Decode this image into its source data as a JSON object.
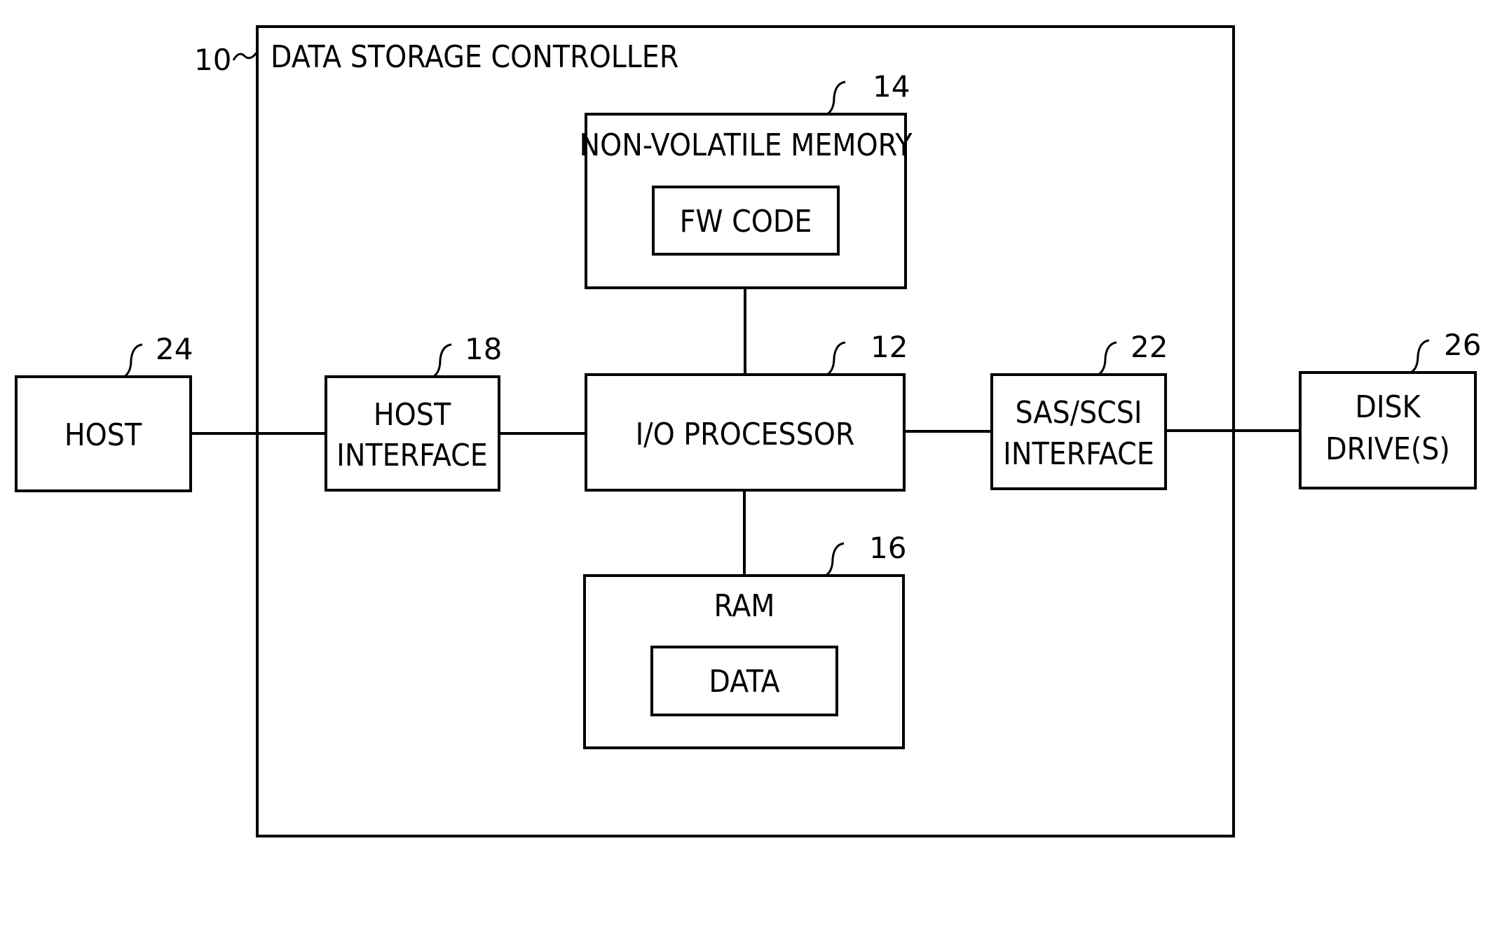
{
  "controller": {
    "ref": "10",
    "label": "DATA STORAGE CONTROLLER"
  },
  "blocks": {
    "nvm": {
      "ref": "14",
      "label": "NON-VOLATILE MEMORY",
      "inner": "FW CODE"
    },
    "io": {
      "ref": "12",
      "label": "I/O PROCESSOR"
    },
    "ram": {
      "ref": "16",
      "label": "RAM",
      "inner": "DATA"
    },
    "host": {
      "ref": "24",
      "label": "HOST"
    },
    "host_if": {
      "ref": "18",
      "line1": "HOST",
      "line2": "INTERFACE"
    },
    "sas": {
      "ref": "22",
      "line1": "SAS/SCSI",
      "line2": "INTERFACE"
    },
    "disk": {
      "ref": "26",
      "line1": "DISK",
      "line2": "DRIVE(S)"
    }
  }
}
